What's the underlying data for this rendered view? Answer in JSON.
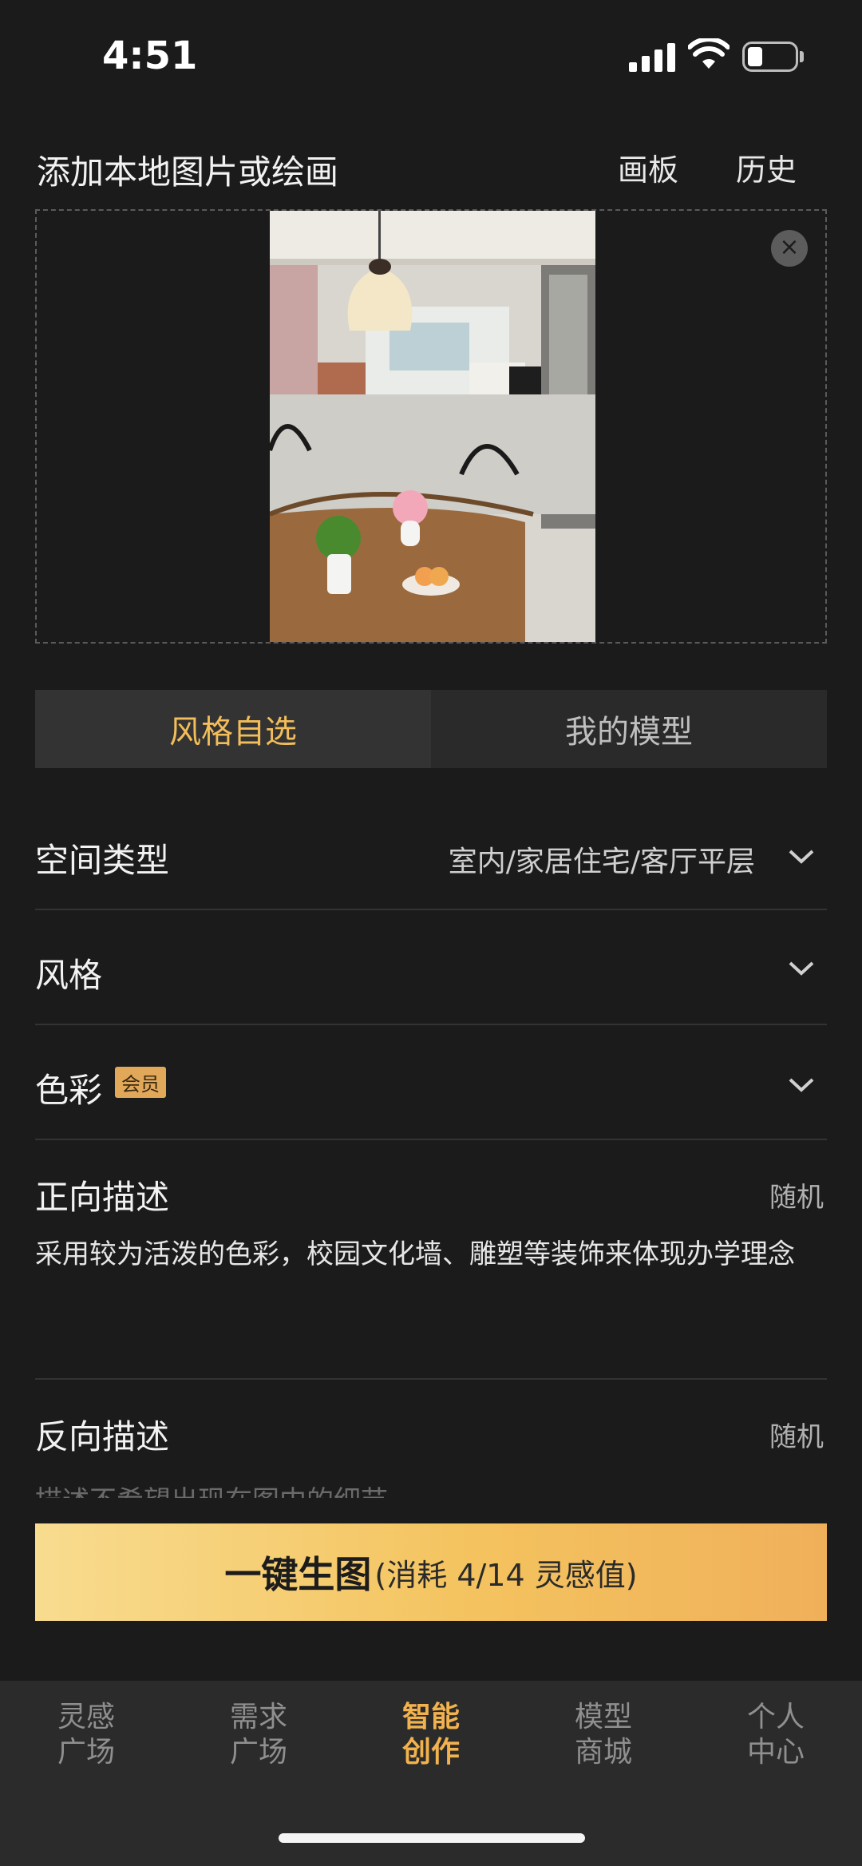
{
  "status": {
    "time": "4:51"
  },
  "header": {
    "title": "添加本地图片或绘画",
    "board": "画板",
    "history": "历史"
  },
  "upload": {
    "close": "×"
  },
  "segment": {
    "tabs": [
      "风格自选",
      "我的模型"
    ]
  },
  "form": {
    "space_type": {
      "label": "空间类型",
      "value": "室内/家居住宅/客厅平层"
    },
    "style": {
      "label": "风格"
    },
    "color": {
      "label": "色彩",
      "badge": "会员"
    },
    "positive": {
      "label": "正向描述",
      "random": "随机",
      "text": "采用较为活泼的色彩，校园文化墙、雕塑等装饰来体现办学理念"
    },
    "negative": {
      "label": "反向描述",
      "random": "随机",
      "placeholder": "描述不希望出现在图中的细节"
    }
  },
  "generate": {
    "main": "一键生图",
    "sub": "(消耗 4/14 灵感值)"
  },
  "tabbar": {
    "items": [
      {
        "line1": "灵感",
        "line2": "广场"
      },
      {
        "line1": "需求",
        "line2": "广场"
      },
      {
        "line1": "智能",
        "line2": "创作"
      },
      {
        "line1": "模型",
        "line2": "商城"
      },
      {
        "line1": "个人",
        "line2": "中心"
      }
    ]
  },
  "colors": {
    "accent": "#f2b24e",
    "background": "#1b1b1b"
  }
}
